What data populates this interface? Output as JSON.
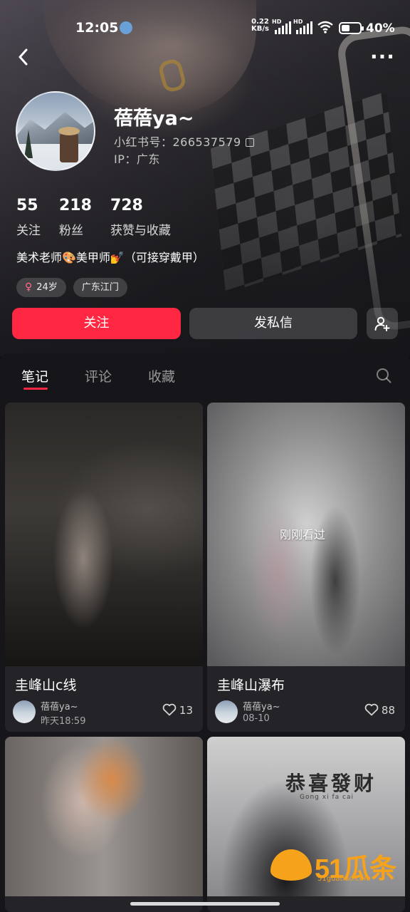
{
  "status_bar": {
    "time": "12:05",
    "net_speed_value": "0.22",
    "net_speed_unit": "KB/s",
    "hd1": "HD",
    "hd2": "HD",
    "battery": "40%"
  },
  "profile": {
    "name": "蓓蓓ya~",
    "id_label": "小红书号：266537579",
    "ip_label": "IP：广东",
    "stats": [
      {
        "value": "55",
        "label": "关注"
      },
      {
        "value": "218",
        "label": "粉丝"
      },
      {
        "value": "728",
        "label": "获赞与收藏"
      }
    ],
    "bio": "美术老师🎨美甲师💅（可接穿戴甲）",
    "tags": [
      {
        "icon": "♀",
        "text": "24岁"
      },
      {
        "text": "广东江门"
      }
    ]
  },
  "actions": {
    "follow": "关注",
    "message": "发私信"
  },
  "tabs": [
    {
      "label": "笔记",
      "active": true
    },
    {
      "label": "评论",
      "active": false
    },
    {
      "label": "收藏",
      "active": false
    }
  ],
  "notes": [
    {
      "title": "圭峰山c线",
      "author": "蓓蓓ya~",
      "date": "昨天18:59",
      "likes": "13"
    },
    {
      "title": "圭峰山瀑布",
      "author": "蓓蓓ya~",
      "date": "08-10",
      "likes": "88",
      "badge": "刚刚看过"
    },
    {
      "overlay_title": "恭喜發财",
      "overlay_sub": "Gong xi fa cai"
    },
    {}
  ],
  "watermark": {
    "text": "51瓜条",
    "url": "51guatiao.com"
  },
  "colors": {
    "accent": "#ff2741",
    "panel": "#16161a",
    "card": "#232328"
  }
}
